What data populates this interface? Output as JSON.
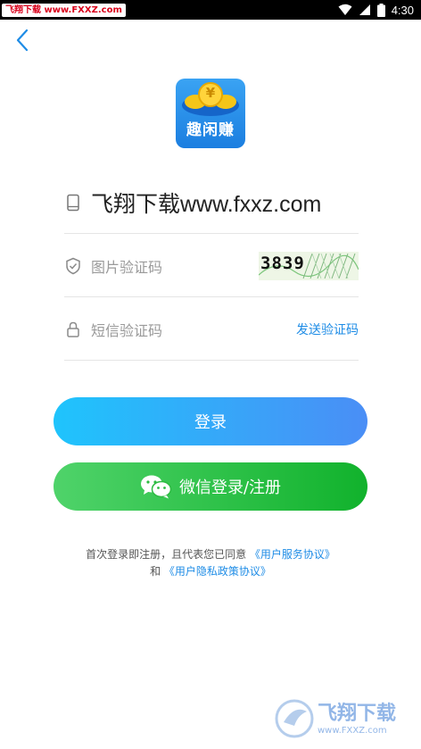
{
  "status_bar": {
    "watermark": "飞翔下载 www.FXXZ.com",
    "time": "4:30"
  },
  "logo": {
    "text": "趣闲赚",
    "coin_symbol": "¥"
  },
  "form": {
    "phone_value": "飞翔下载www.fxxz.com",
    "captcha_placeholder": "图片验证码",
    "captcha_code": "3839",
    "sms_placeholder": "短信验证码",
    "send_code_label": "发送验证码"
  },
  "buttons": {
    "login_label": "登录",
    "wechat_label": "微信登录/注册"
  },
  "agreement": {
    "prefix": "首次登录即注册，且代表您已同意",
    "terms_link": "《用户服务协议》",
    "conj": "和",
    "privacy_link": "《用户隐私政策协议》"
  },
  "watermark": {
    "title": "飞翔下载",
    "url": "www.FXXZ.com"
  },
  "colors": {
    "accent_blue": "#1e8ce6",
    "login_gradient_start": "#1fc4fc",
    "login_gradient_end": "#4a8ef6",
    "wechat_gradient_start": "#4fd36a",
    "wechat_gradient_end": "#11b22c"
  }
}
